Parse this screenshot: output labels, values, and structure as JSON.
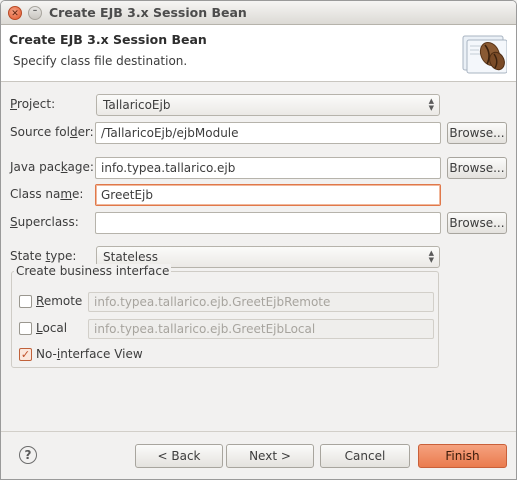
{
  "window": {
    "title": "Create EJB 3.x Session Bean",
    "close_glyph": "✕",
    "min_glyph": "–"
  },
  "header": {
    "title": "Create EJB 3.x Session Bean",
    "subtitle": "Specify class file destination.",
    "icon": "coffee-bean-icon"
  },
  "form": {
    "project": {
      "label_pre": "",
      "label_u": "P",
      "label_post": "roject:",
      "value": "TallaricoEjb"
    },
    "source_folder": {
      "label_pre": "Source fol",
      "label_u": "d",
      "label_post": "er:",
      "value": "/TallaricoEjb/ejbModule",
      "browse": "Browse..."
    },
    "java_package": {
      "label_pre": "Java pac",
      "label_u": "k",
      "label_post": "age:",
      "value": "info.typea.tallarico.ejb",
      "browse": "Browse..."
    },
    "class_name": {
      "label_pre": "Class na",
      "label_u": "m",
      "label_post": "e:",
      "value": "GreetEjb"
    },
    "superclass": {
      "label_pre": "",
      "label_u": "S",
      "label_post": "uperclass:",
      "value": "",
      "browse": "Browse..."
    },
    "state_type": {
      "label_pre": "State ",
      "label_u": "t",
      "label_post": "ype:",
      "value": "Stateless"
    }
  },
  "business_interface": {
    "title": "Create business interface",
    "remote": {
      "label_pre": "",
      "label_u": "R",
      "label_post": "emote",
      "checked": false,
      "value": "info.typea.tallarico.ejb.GreetEjbRemote"
    },
    "local": {
      "label_pre": "",
      "label_u": "L",
      "label_post": "ocal",
      "checked": false,
      "value": "info.typea.tallarico.ejb.GreetEjbLocal"
    },
    "no_interface": {
      "label_pre": "No-",
      "label_u": "i",
      "label_post": "nterface View",
      "checked": true,
      "check_glyph": "✓"
    }
  },
  "footer": {
    "help_glyph": "?",
    "back": "< Back",
    "next": "Next >",
    "cancel": "Cancel",
    "finish": "Finish"
  },
  "colors": {
    "accent": "#ea7b4e",
    "focus_border": "#e0784a",
    "background": "#f2f1f0"
  }
}
